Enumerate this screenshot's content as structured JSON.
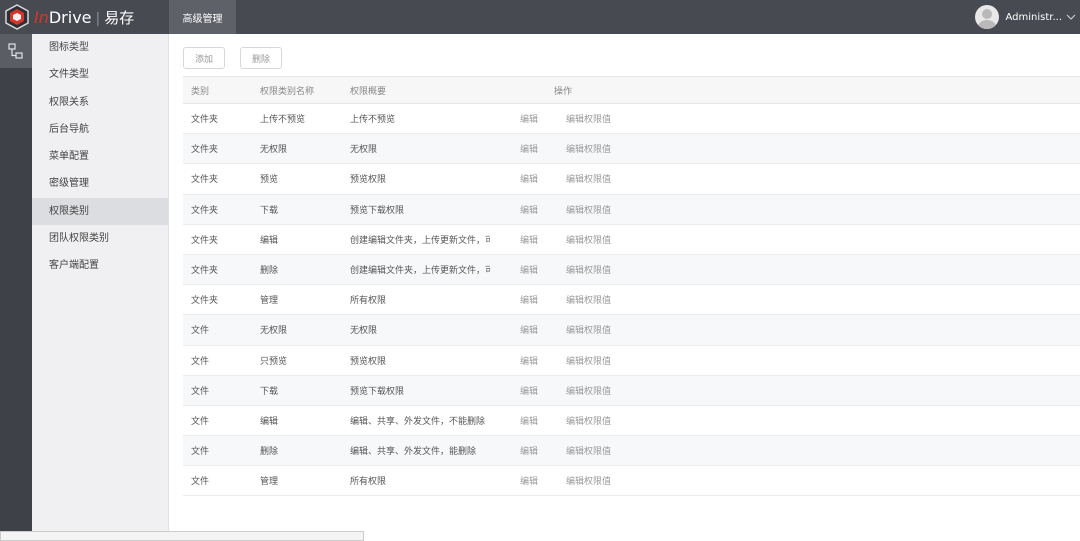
{
  "header": {
    "logo_in": "In",
    "logo_drive": "Drive",
    "logo_separator": "|",
    "logo_cn": "易存",
    "nav_tab": "高级管理",
    "user_name": "Administr...",
    "user_chevron_icon": "chevron-down-icon"
  },
  "sidebar": {
    "items": [
      {
        "label": "图标类型"
      },
      {
        "label": "文件类型"
      },
      {
        "label": "权限关系"
      },
      {
        "label": "后台导航"
      },
      {
        "label": "菜单配置"
      },
      {
        "label": "密级管理"
      },
      {
        "label": "权限类别"
      },
      {
        "label": "团队权限类别"
      },
      {
        "label": "客户端配置"
      }
    ],
    "active_index": 6
  },
  "toolbar": {
    "add_label": "添加",
    "delete_label": "删除"
  },
  "table": {
    "headers": {
      "category": "类别",
      "name": "权限类别名称",
      "summary": "权限概要",
      "operations": "操作"
    },
    "rows": [
      {
        "category": "文件夹",
        "name": "上传不预览",
        "summary": "上传不预览",
        "edit": "编辑",
        "edit_value": "编辑权限值"
      },
      {
        "category": "文件夹",
        "name": "无权限",
        "summary": "无权限",
        "edit": "编辑",
        "edit_value": "编辑权限值"
      },
      {
        "category": "文件夹",
        "name": "预览",
        "summary": "预览权限",
        "edit": "编辑",
        "edit_value": "编辑权限值"
      },
      {
        "category": "文件夹",
        "name": "下载",
        "summary": "预览下载权限",
        "edit": "编辑",
        "edit_value": "编辑权限值"
      },
      {
        "category": "文件夹",
        "name": "编辑",
        "summary": "创建编辑文件夹，上传更新文件，可夕",
        "edit": "编辑",
        "edit_value": "编辑权限值"
      },
      {
        "category": "文件夹",
        "name": "删除",
        "summary": "创建编辑文件夹，上传更新文件，可夕",
        "edit": "编辑",
        "edit_value": "编辑权限值"
      },
      {
        "category": "文件夹",
        "name": "管理",
        "summary": "所有权限",
        "edit": "编辑",
        "edit_value": "编辑权限值"
      },
      {
        "category": "文件",
        "name": "无权限",
        "summary": "无权限",
        "edit": "编辑",
        "edit_value": "编辑权限值"
      },
      {
        "category": "文件",
        "name": "只预览",
        "summary": "预览权限",
        "edit": "编辑",
        "edit_value": "编辑权限值"
      },
      {
        "category": "文件",
        "name": "下载",
        "summary": "预览下载权限",
        "edit": "编辑",
        "edit_value": "编辑权限值"
      },
      {
        "category": "文件",
        "name": "编辑",
        "summary": "编辑、共享、外发文件，不能删除",
        "edit": "编辑",
        "edit_value": "编辑权限值"
      },
      {
        "category": "文件",
        "name": "删除",
        "summary": "编辑、共享、外发文件，能删除",
        "edit": "编辑",
        "edit_value": "编辑权限值"
      },
      {
        "category": "文件",
        "name": "管理",
        "summary": "所有权限",
        "edit": "编辑",
        "edit_value": "编辑权限值"
      }
    ]
  },
  "colors": {
    "topbar": "#484a52",
    "tab_active": "#5f6169",
    "logo_accent": "#d9342b",
    "sidebar_bg": "#f0f0f2",
    "sidebar_active": "#dcdde0"
  },
  "icons": {
    "logo": "indrive-logo-icon",
    "rail": "tree-structure-icon",
    "avatar": "user-avatar-icon"
  }
}
